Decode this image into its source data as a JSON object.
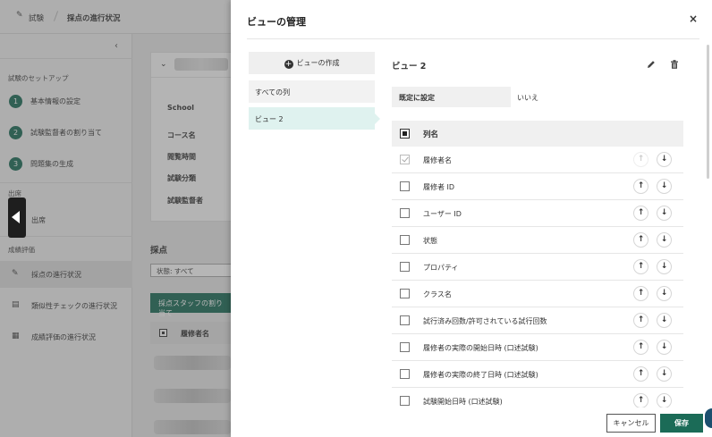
{
  "breadcrumb": {
    "root": "試験",
    "current": "採点の進行状況"
  },
  "sidebar": {
    "collapse_icon": "chevron-left",
    "setup_title": "試験のセットアップ",
    "steps": [
      {
        "num": "1",
        "label": "基本情報の設定"
      },
      {
        "num": "2",
        "label": "試験監督者の割り当て"
      },
      {
        "num": "3",
        "label": "問題集の生成"
      }
    ],
    "attendance_title": "出席",
    "attendance_item": "出席",
    "grading_title": "成績評価",
    "grading_items": [
      {
        "label": "採点の進行状況",
        "icon": "pencil-icon",
        "active": true
      },
      {
        "label": "類似性チェックの進行状況",
        "icon": "clipboard-icon",
        "active": false
      },
      {
        "label": "成績評価の進行状況",
        "icon": "document-icon",
        "active": false
      }
    ]
  },
  "background_card": {
    "rows": [
      "School",
      "コース名",
      "閲覧時間",
      "試験分類",
      "試験監督者"
    ]
  },
  "background_grading": {
    "heading": "採点",
    "filter": "状態: すべて",
    "assign_button": "採点スタッフの割り当て",
    "table_header": "履修者名"
  },
  "dialog": {
    "title": "ビューの管理",
    "close": "×",
    "create_view": "ビューの作成",
    "views": [
      {
        "label": "すべての列",
        "selected": false
      },
      {
        "label": "ビュー 2",
        "selected": true
      }
    ],
    "selected_view_name": "ビュー 2",
    "default_label": "既定に設定",
    "default_value": "いいえ",
    "column_header": "列名",
    "columns": [
      {
        "label": "履修者名",
        "checked": true,
        "locked": true,
        "up_disabled": true
      },
      {
        "label": "履修者 ID",
        "checked": false,
        "locked": false,
        "up_disabled": false
      },
      {
        "label": "ユーザー ID",
        "checked": false,
        "locked": false,
        "up_disabled": false
      },
      {
        "label": "状態",
        "checked": false,
        "locked": false,
        "up_disabled": false
      },
      {
        "label": "プロパティ",
        "checked": false,
        "locked": false,
        "up_disabled": false
      },
      {
        "label": "クラス名",
        "checked": false,
        "locked": false,
        "up_disabled": false
      },
      {
        "label": "試行済み回数/許可されている試行回数",
        "checked": false,
        "locked": false,
        "up_disabled": false
      },
      {
        "label": "履修者の実際の開始日時 (口述試験)",
        "checked": false,
        "locked": false,
        "up_disabled": false
      },
      {
        "label": "履修者の実際の終了日時 (口述試験)",
        "checked": false,
        "locked": false,
        "up_disabled": false
      },
      {
        "label": "試験開始日時 (口述試験)",
        "checked": false,
        "locked": false,
        "up_disabled": false
      }
    ],
    "cancel": "キャンセル",
    "save": "保存"
  },
  "colors": {
    "accent": "#1b6b57",
    "selected_bg": "#dff2ef"
  }
}
